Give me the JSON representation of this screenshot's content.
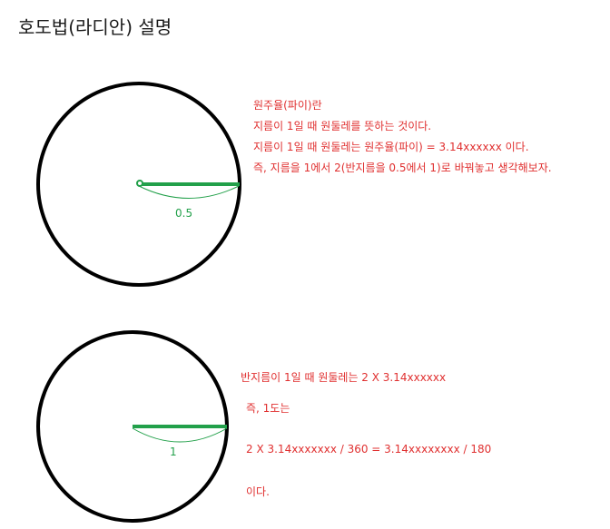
{
  "title": "호도법(라디안) 설명",
  "colors": {
    "circle": "#000000",
    "radius": "#22a04a",
    "note_text": "#e03030",
    "title_text": "#1a1a1a"
  },
  "top_section": {
    "radius_label": "0.5",
    "notes": [
      "원주율(파이)란",
      "지름이 1일 때 원둘레를 뜻하는 것이다.",
      "지름이 1일 때 원둘레는 원주율(파이) = 3.14xxxxxx 이다.",
      "즉, 지름을 1에서 2(반지름을 0.5에서 1)로 바꿔놓고 생각해보자."
    ]
  },
  "bottom_section": {
    "radius_label": "1",
    "notes": [
      "반지름이 1일 때 원둘레는 2 X 3.14xxxxxx",
      "즉, 1도는",
      "2 X 3.14xxxxxxx / 360 = 3.14xxxxxxxx / 180",
      "이다."
    ]
  }
}
